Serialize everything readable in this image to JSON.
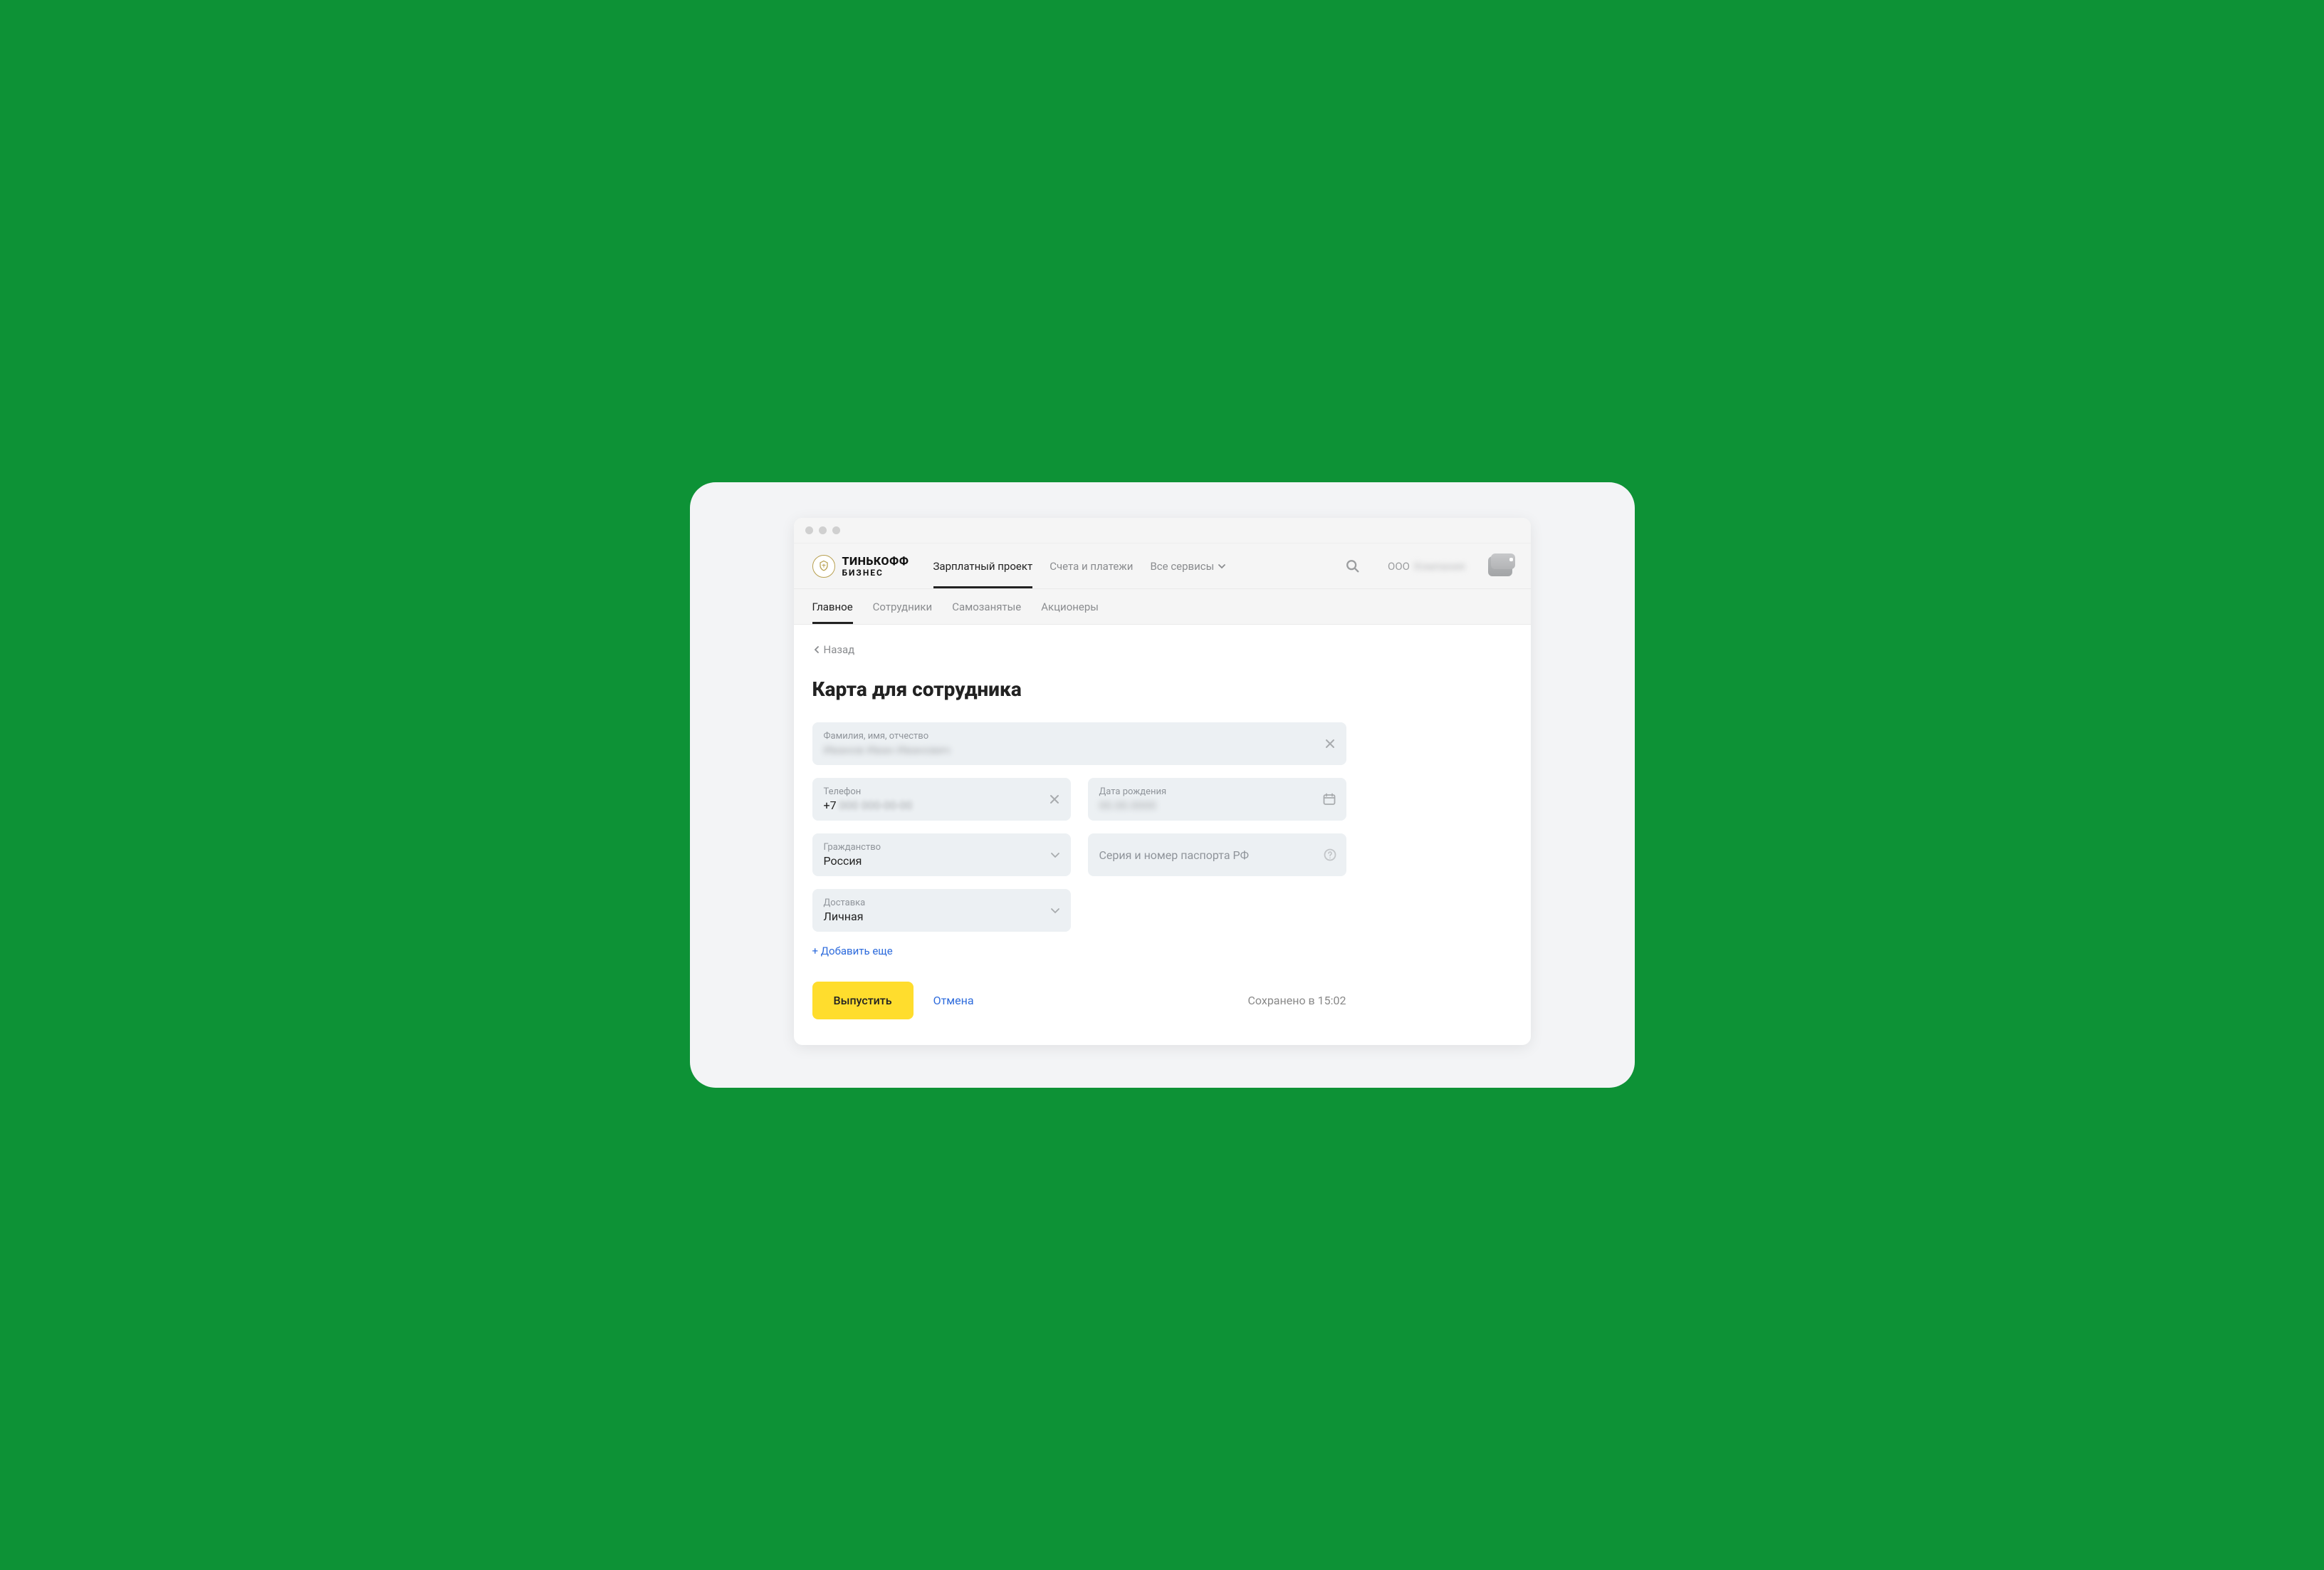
{
  "brand": {
    "name": "ТИНЬКОФФ",
    "sub": "БИЗНЕС"
  },
  "topnav": {
    "payroll": "Зарплатный проект",
    "accounts": "Счета и платежи",
    "services": "Все сервисы"
  },
  "org": {
    "prefix": "ООО",
    "name": "Компания"
  },
  "subnav": {
    "main": "Главное",
    "employees": "Сотрудники",
    "selfemployed": "Самозанятые",
    "shareholders": "Акционеры"
  },
  "back": "Назад",
  "page_title": "Карта для сотрудника",
  "fields": {
    "fio": {
      "label": "Фамилия, имя, отчество",
      "value": "Иванов Иван Иванович"
    },
    "phone": {
      "label": "Телефон",
      "prefix": "+7",
      "rest": " 000 000-00-00"
    },
    "dob": {
      "label": "Дата рождения",
      "value": "00.00.0000"
    },
    "citizenship": {
      "label": "Гражданство",
      "value": "Россия"
    },
    "passport": {
      "placeholder": "Серия и номер паспорта РФ"
    },
    "delivery": {
      "label": "Доставка",
      "value": "Личная"
    }
  },
  "actions": {
    "add_more": "+ Добавить еще",
    "submit": "Выпустить",
    "cancel": "Отмена",
    "saved": "Сохранено в 15:02"
  }
}
